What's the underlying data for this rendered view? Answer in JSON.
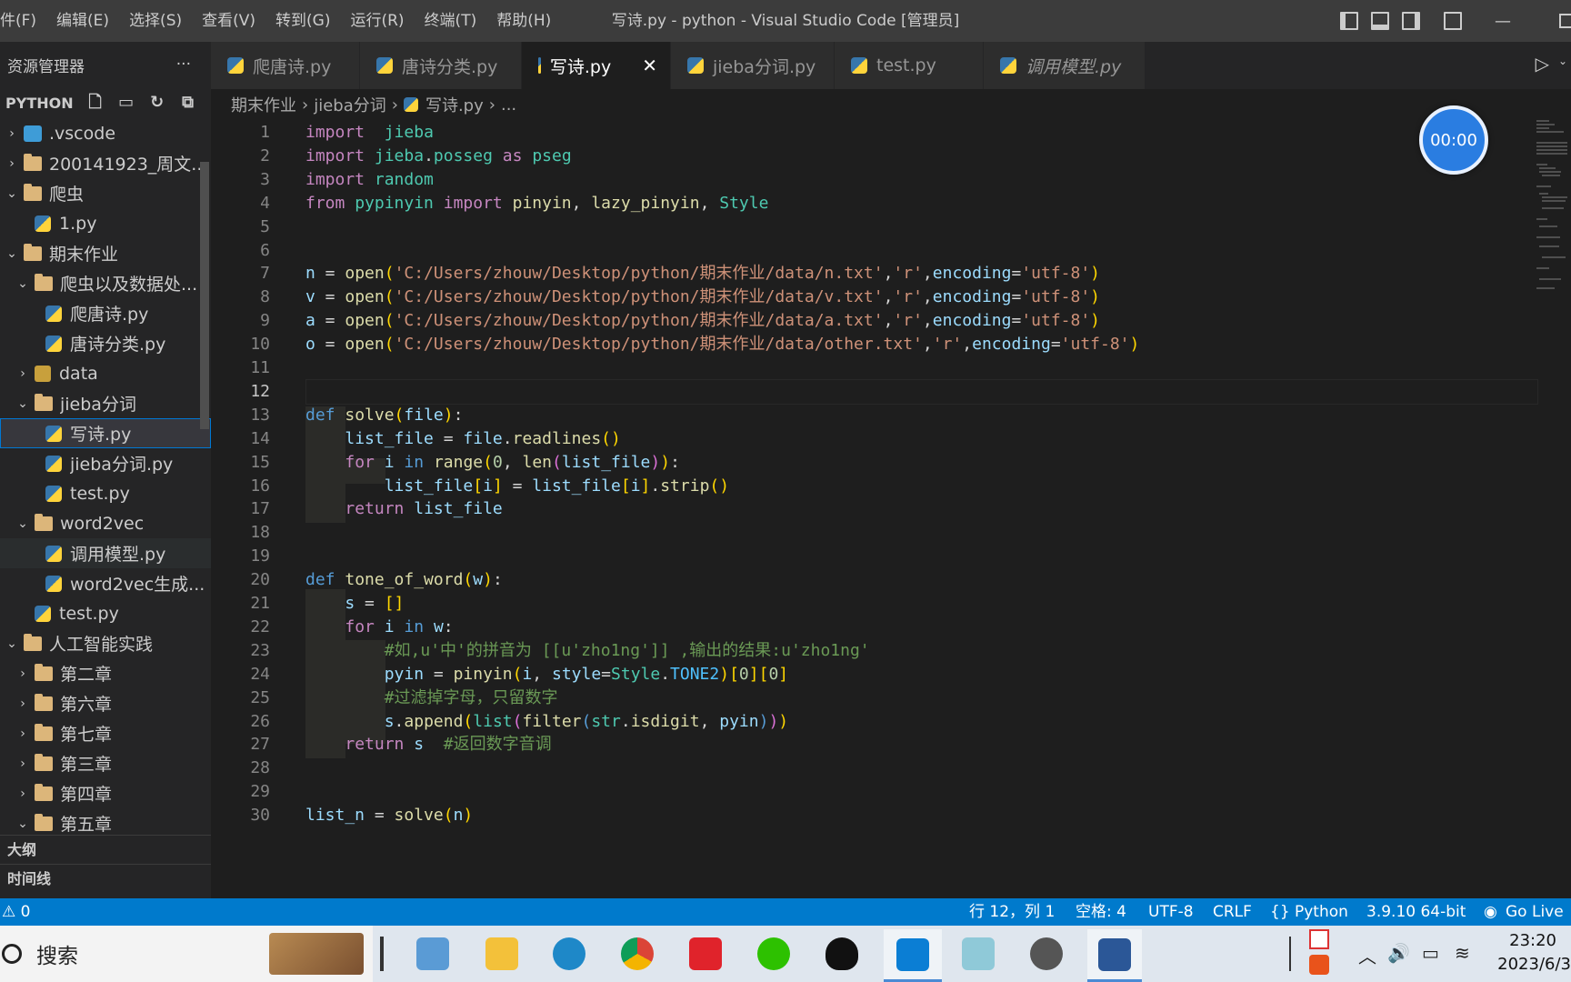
{
  "window": {
    "title": "写诗.py - python - Visual Studio Code [管理员]",
    "menu": [
      "件(F)",
      "编辑(E)",
      "选择(S)",
      "查看(V)",
      "转到(G)",
      "运行(R)",
      "终端(T)",
      "帮助(H)"
    ]
  },
  "sidebar": {
    "title": "资源管理器",
    "more": "···",
    "project": "PYTHON",
    "tree": [
      {
        "label": ".vscode",
        "kind": "vscode",
        "depth": 0,
        "chev": "›"
      },
      {
        "label": "200141923_周文...",
        "kind": "folder",
        "depth": 0,
        "chev": "›"
      },
      {
        "label": "爬虫",
        "kind": "folder",
        "depth": 0,
        "chev": "⌄"
      },
      {
        "label": "1.py",
        "kind": "py",
        "depth": 1,
        "chev": ""
      },
      {
        "label": "期末作业",
        "kind": "folder",
        "depth": 0,
        "chev": "⌄"
      },
      {
        "label": "爬虫以及数据处...",
        "kind": "folder",
        "depth": 1,
        "chev": "⌄"
      },
      {
        "label": "爬唐诗.py",
        "kind": "py",
        "depth": 2,
        "chev": ""
      },
      {
        "label": "唐诗分类.py",
        "kind": "py",
        "depth": 2,
        "chev": ""
      },
      {
        "label": "data",
        "kind": "data",
        "depth": 1,
        "chev": "›"
      },
      {
        "label": "jieba分词",
        "kind": "folder",
        "depth": 1,
        "chev": "⌄"
      },
      {
        "label": "写诗.py",
        "kind": "py",
        "depth": 2,
        "chev": "",
        "selected": true
      },
      {
        "label": "jieba分词.py",
        "kind": "py",
        "depth": 2,
        "chev": ""
      },
      {
        "label": "test.py",
        "kind": "py",
        "depth": 2,
        "chev": ""
      },
      {
        "label": "word2vec",
        "kind": "folder",
        "depth": 1,
        "chev": "⌄"
      },
      {
        "label": "调用模型.py",
        "kind": "py",
        "depth": 2,
        "chev": "",
        "hovered": true
      },
      {
        "label": "word2vec生成...",
        "kind": "py",
        "depth": 2,
        "chev": ""
      },
      {
        "label": "test.py",
        "kind": "py",
        "depth": 1,
        "chev": ""
      },
      {
        "label": "人工智能实践",
        "kind": "folder",
        "depth": 0,
        "chev": "⌄"
      },
      {
        "label": "第二章",
        "kind": "folder",
        "depth": 1,
        "chev": "›"
      },
      {
        "label": "第六章",
        "kind": "folder",
        "depth": 1,
        "chev": "›"
      },
      {
        "label": "第七章",
        "kind": "folder",
        "depth": 1,
        "chev": "›"
      },
      {
        "label": "第三章",
        "kind": "folder",
        "depth": 1,
        "chev": "›"
      },
      {
        "label": "第四章",
        "kind": "folder",
        "depth": 1,
        "chev": "›"
      },
      {
        "label": "第五章",
        "kind": "folder",
        "depth": 1,
        "chev": "⌄"
      }
    ],
    "outline": "大纲",
    "timeline": "时间线"
  },
  "tabs": [
    {
      "label": "爬唐诗.py",
      "active": false,
      "italic": false
    },
    {
      "label": "唐诗分类.py",
      "active": false,
      "italic": false
    },
    {
      "label": "写诗.py",
      "active": true,
      "italic": false
    },
    {
      "label": "jieba分词.py",
      "active": false,
      "italic": false
    },
    {
      "label": "test.py",
      "active": false,
      "italic": false
    },
    {
      "label": "调用模型.py",
      "active": false,
      "italic": true
    }
  ],
  "tab_close": "✕",
  "breadcrumb": [
    "期末作业",
    "jieba分词",
    "写诗.py",
    "..."
  ],
  "timer": "00:00",
  "editor": {
    "current_line": 12,
    "lines": [
      [
        [
          "kw",
          "import"
        ],
        [
          "",
          "  "
        ],
        [
          "mod",
          "jieba"
        ]
      ],
      [
        [
          "kw",
          "import"
        ],
        [
          "",
          " "
        ],
        [
          "mod",
          "jieba"
        ],
        [
          "",
          "."
        ],
        [
          "mod",
          "posseg"
        ],
        [
          "",
          " "
        ],
        [
          "kw",
          "as"
        ],
        [
          "",
          " "
        ],
        [
          "mod",
          "pseg"
        ]
      ],
      [
        [
          "kw",
          "import"
        ],
        [
          "",
          " "
        ],
        [
          "mod",
          "random"
        ]
      ],
      [
        [
          "kw",
          "from"
        ],
        [
          "",
          " "
        ],
        [
          "mod",
          "pypinyin"
        ],
        [
          "",
          " "
        ],
        [
          "kw",
          "import"
        ],
        [
          "",
          " "
        ],
        [
          "fn",
          "pinyin"
        ],
        [
          "",
          ", "
        ],
        [
          "fn",
          "lazy_pinyin"
        ],
        [
          "",
          ", "
        ],
        [
          "mod",
          "Style"
        ]
      ],
      [],
      [],
      [
        [
          "var",
          "n"
        ],
        [
          "",
          " = "
        ],
        [
          "fn",
          "open"
        ],
        [
          "br1",
          "("
        ],
        [
          "str",
          "'C:/Users/zhouw/Desktop/python/期末作业/data/n.txt'"
        ],
        [
          "",
          ","
        ],
        [
          "str",
          "'r'"
        ],
        [
          "",
          ","
        ],
        [
          "var",
          "encoding"
        ],
        [
          "",
          "="
        ],
        [
          "str",
          "'utf-8'"
        ],
        [
          "br1",
          ")"
        ]
      ],
      [
        [
          "var",
          "v"
        ],
        [
          "",
          " = "
        ],
        [
          "fn",
          "open"
        ],
        [
          "br1",
          "("
        ],
        [
          "str",
          "'C:/Users/zhouw/Desktop/python/期末作业/data/v.txt'"
        ],
        [
          "",
          ","
        ],
        [
          "str",
          "'r'"
        ],
        [
          "",
          ","
        ],
        [
          "var",
          "encoding"
        ],
        [
          "",
          "="
        ],
        [
          "str",
          "'utf-8'"
        ],
        [
          "br1",
          ")"
        ]
      ],
      [
        [
          "var",
          "a"
        ],
        [
          "",
          " = "
        ],
        [
          "fn",
          "open"
        ],
        [
          "br1",
          "("
        ],
        [
          "str",
          "'C:/Users/zhouw/Desktop/python/期末作业/data/a.txt'"
        ],
        [
          "",
          ","
        ],
        [
          "str",
          "'r'"
        ],
        [
          "",
          ","
        ],
        [
          "var",
          "encoding"
        ],
        [
          "",
          "="
        ],
        [
          "str",
          "'utf-8'"
        ],
        [
          "br1",
          ")"
        ]
      ],
      [
        [
          "var",
          "o"
        ],
        [
          "",
          " = "
        ],
        [
          "fn",
          "open"
        ],
        [
          "br1",
          "("
        ],
        [
          "str",
          "'C:/Users/zhouw/Desktop/python/期末作业/data/other.txt'"
        ],
        [
          "",
          ","
        ],
        [
          "str",
          "'r'"
        ],
        [
          "",
          ","
        ],
        [
          "var",
          "encoding"
        ],
        [
          "",
          "="
        ],
        [
          "str",
          "'utf-8'"
        ],
        [
          "br1",
          ")"
        ]
      ],
      [],
      [],
      [
        [
          "kb",
          "def"
        ],
        [
          "",
          " "
        ],
        [
          "fn",
          "solve"
        ],
        [
          "br1",
          "("
        ],
        [
          "var",
          "file"
        ],
        [
          "br1",
          ")"
        ],
        [
          "",
          ":"
        ]
      ],
      [
        [
          "",
          "    "
        ],
        [
          "var",
          "list_file"
        ],
        [
          "",
          " = "
        ],
        [
          "var",
          "file"
        ],
        [
          "",
          "."
        ],
        [
          "fn",
          "readlines"
        ],
        [
          "br1",
          "()"
        ]
      ],
      [
        [
          "",
          "    "
        ],
        [
          "kw",
          "for"
        ],
        [
          "",
          " "
        ],
        [
          "var",
          "i"
        ],
        [
          "",
          " "
        ],
        [
          "kb",
          "in"
        ],
        [
          "",
          " "
        ],
        [
          "fn",
          "range"
        ],
        [
          "br1",
          "("
        ],
        [
          "num",
          "0"
        ],
        [
          "",
          ", "
        ],
        [
          "fn",
          "len"
        ],
        [
          "br2",
          "("
        ],
        [
          "var",
          "list_file"
        ],
        [
          "br2",
          ")"
        ],
        [
          "br1",
          ")"
        ],
        [
          "",
          ":"
        ]
      ],
      [
        [
          "",
          "        "
        ],
        [
          "var",
          "list_file"
        ],
        [
          "br1",
          "["
        ],
        [
          "var",
          "i"
        ],
        [
          "br1",
          "]"
        ],
        [
          "",
          " = "
        ],
        [
          "var",
          "list_file"
        ],
        [
          "br1",
          "["
        ],
        [
          "var",
          "i"
        ],
        [
          "br1",
          "]"
        ],
        [
          "",
          "."
        ],
        [
          "fn",
          "strip"
        ],
        [
          "br1",
          "()"
        ]
      ],
      [
        [
          "",
          "    "
        ],
        [
          "kw",
          "return"
        ],
        [
          "",
          " "
        ],
        [
          "var",
          "list_file"
        ]
      ],
      [],
      [],
      [
        [
          "kb",
          "def"
        ],
        [
          "",
          " "
        ],
        [
          "fn",
          "tone_of_word"
        ],
        [
          "br1",
          "("
        ],
        [
          "var",
          "w"
        ],
        [
          "br1",
          ")"
        ],
        [
          "",
          ":"
        ]
      ],
      [
        [
          "",
          "    "
        ],
        [
          "var",
          "s"
        ],
        [
          "",
          " = "
        ],
        [
          "br1",
          "[]"
        ]
      ],
      [
        [
          "",
          "    "
        ],
        [
          "kw",
          "for"
        ],
        [
          "",
          " "
        ],
        [
          "var",
          "i"
        ],
        [
          "",
          " "
        ],
        [
          "kb",
          "in"
        ],
        [
          "",
          " "
        ],
        [
          "var",
          "w"
        ],
        [
          "",
          ":"
        ]
      ],
      [
        [
          "",
          "        "
        ],
        [
          "cm",
          "#如,u'中'的拼音为 [[u'zho1ng']] ,输出的结果:u'zho1ng'"
        ]
      ],
      [
        [
          "",
          "        "
        ],
        [
          "var",
          "pyin"
        ],
        [
          "",
          " = "
        ],
        [
          "fn",
          "pinyin"
        ],
        [
          "br1",
          "("
        ],
        [
          "var",
          "i"
        ],
        [
          "",
          ", "
        ],
        [
          "var",
          "style"
        ],
        [
          "",
          "="
        ],
        [
          "mod",
          "Style"
        ],
        [
          "",
          "."
        ],
        [
          "const",
          "TONE2"
        ],
        [
          "br1",
          ")"
        ],
        [
          "br1",
          "["
        ],
        [
          "num",
          "0"
        ],
        [
          "br1",
          "]"
        ],
        [
          "br1",
          "["
        ],
        [
          "num",
          "0"
        ],
        [
          "br1",
          "]"
        ]
      ],
      [
        [
          "",
          "        "
        ],
        [
          "cm",
          "#过滤掉字母，只留数字"
        ]
      ],
      [
        [
          "",
          "        "
        ],
        [
          "var",
          "s"
        ],
        [
          "",
          "."
        ],
        [
          "fn",
          "append"
        ],
        [
          "br1",
          "("
        ],
        [
          "mod",
          "list"
        ],
        [
          "br2",
          "("
        ],
        [
          "fn",
          "filter"
        ],
        [
          "kb",
          "("
        ],
        [
          "mod",
          "str"
        ],
        [
          "",
          "."
        ],
        [
          "fn",
          "isdigit"
        ],
        [
          "",
          ", "
        ],
        [
          "var",
          "pyin"
        ],
        [
          "kb",
          ")"
        ],
        [
          "br2",
          ")"
        ],
        [
          "br1",
          ")"
        ]
      ],
      [
        [
          "",
          "    "
        ],
        [
          "kw",
          "return"
        ],
        [
          "",
          " "
        ],
        [
          "var",
          "s"
        ],
        [
          "",
          "  "
        ],
        [
          "cm",
          "#返回数字音调"
        ]
      ],
      [],
      [],
      [
        [
          "var",
          "list_n"
        ],
        [
          "",
          " = "
        ],
        [
          "fn",
          "solve"
        ],
        [
          "br1",
          "("
        ],
        [
          "var",
          "n"
        ],
        [
          "br1",
          ")"
        ]
      ]
    ]
  },
  "statusbar": {
    "problems": "⚠ 0",
    "position": "行 12，列 1",
    "spaces": "空格: 4",
    "encoding": "UTF-8",
    "eol": "CRLF",
    "language": "Python",
    "interpreter": "3.9.10 64-bit",
    "golive": "Go Live"
  },
  "taskbar": {
    "search": "搜索",
    "time": "23:20",
    "date": "2023/6/3"
  }
}
